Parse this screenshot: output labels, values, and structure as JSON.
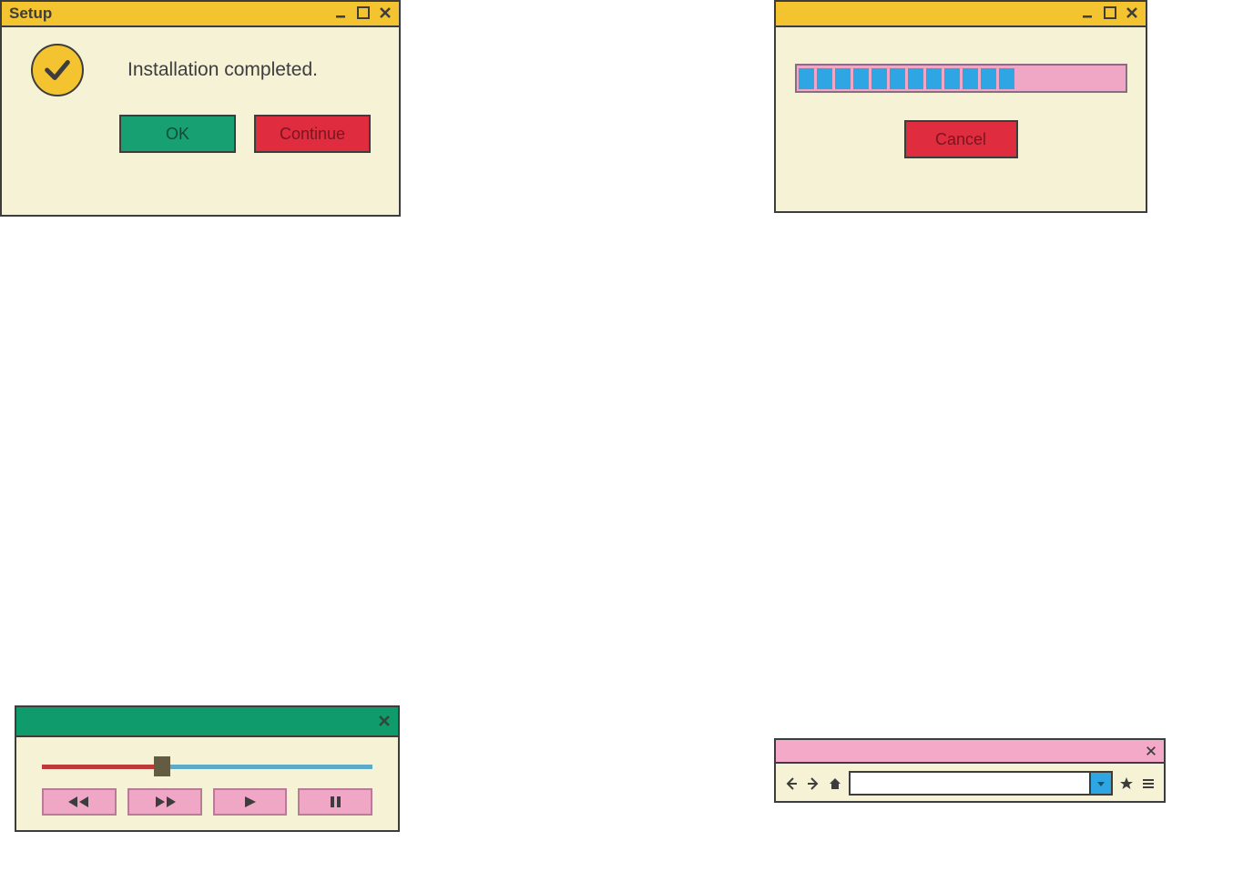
{
  "setup": {
    "title": "Setup",
    "message": "Installation completed.",
    "ok_label": "OK",
    "continue_label": "Continue"
  },
  "progress": {
    "cancel_label": "Cancel",
    "filled_segments": 12,
    "total_width_segments": 20
  },
  "media": {
    "slider_position_pct": 35
  },
  "browser": {
    "url": ""
  }
}
